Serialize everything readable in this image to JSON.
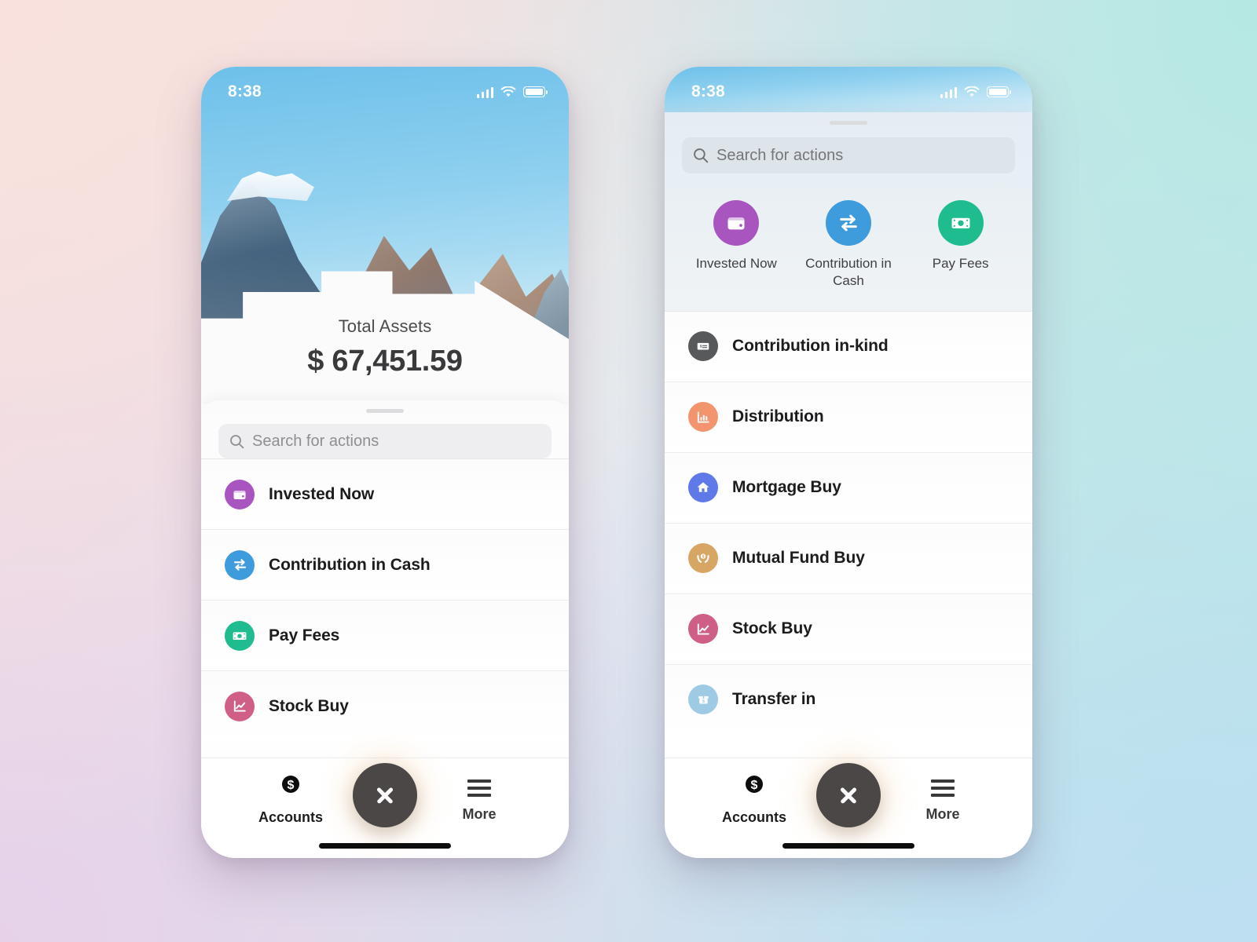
{
  "status_bar": {
    "time": "8:38",
    "signal_icon": "signal-bars-icon",
    "wifi_icon": "wifi-icon",
    "battery_icon": "battery-icon"
  },
  "colors": {
    "purple": "#a855c0",
    "blue": "#3e9bdc",
    "green": "#1ebc8f",
    "rose": "#cf5f86",
    "orange": "#f2956e",
    "indigo": "#5f79e8",
    "tan": "#d7a564",
    "sky": "#9ecbe3",
    "gray": "#58595b",
    "fab": "#4a4746",
    "background_top_left": "#f7e0dc",
    "background_top_right": "#b5e8e3",
    "background_bottom_left": "#e6d1e9",
    "background_bottom_right": "#bddff1"
  },
  "left_screen": {
    "hero": {
      "image_name": "mountain-photo",
      "total_label": "Total Assets",
      "total_amount": "$ 67,451.59"
    },
    "search": {
      "placeholder": "Search for actions",
      "icon": "search-icon"
    },
    "actions": [
      {
        "label": "Invested Now",
        "icon": "wallet-icon",
        "color": "#a855c0"
      },
      {
        "label": "Contribution in Cash",
        "icon": "transfer-icon",
        "color": "#3e9bdc"
      },
      {
        "label": "Pay Fees",
        "icon": "banknote-icon",
        "color": "#1ebc8f"
      },
      {
        "label": "Stock Buy",
        "icon": "line-chart-icon",
        "color": "#cf5f86"
      }
    ]
  },
  "right_screen": {
    "search": {
      "placeholder": "Search for actions",
      "icon": "search-icon"
    },
    "quick_actions": [
      {
        "label": "Invested Now",
        "icon": "wallet-icon",
        "color": "#a855c0"
      },
      {
        "label": "Contribution in Cash",
        "icon": "transfer-icon",
        "color": "#3e9bdc"
      },
      {
        "label": "Pay Fees",
        "icon": "banknote-icon",
        "color": "#1ebc8f"
      }
    ],
    "actions": [
      {
        "label": "Contribution in-kind",
        "icon": "check-document-icon",
        "color": "#58595b"
      },
      {
        "label": "Distribution",
        "icon": "bar-chart-icon",
        "color": "#f2956e"
      },
      {
        "label": "Mortgage Buy",
        "icon": "house-icon",
        "color": "#5f79e8"
      },
      {
        "label": "Mutual Fund Buy",
        "icon": "hands-money-icon",
        "color": "#d7a564"
      },
      {
        "label": "Stock Buy",
        "icon": "line-chart-icon",
        "color": "#cf5f86"
      },
      {
        "label": "Transfer in",
        "icon": "box-money-icon",
        "color": "#9ecbe3"
      }
    ]
  },
  "tab_bar": {
    "accounts_label": "Accounts",
    "accounts_icon": "dollar-circle-icon",
    "more_label": "More",
    "more_icon": "hamburger-icon",
    "close_icon": "close-icon"
  }
}
